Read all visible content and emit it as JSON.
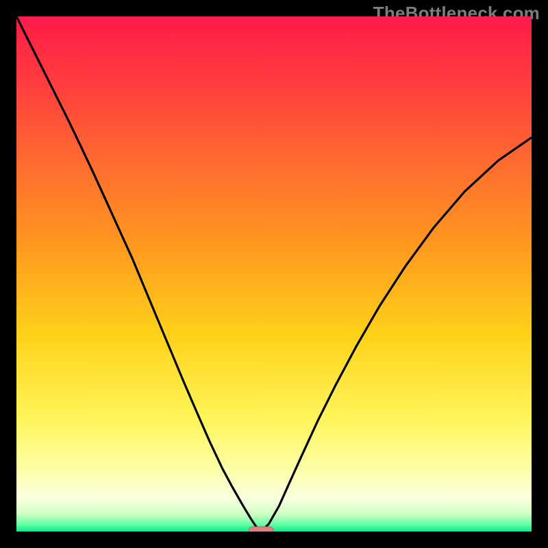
{
  "watermark": "TheBottleneck.com",
  "colors": {
    "frame": "#000000",
    "curve": "#000000",
    "marker_fill": "#e08080",
    "marker_stroke": "#c86060",
    "gradient_stops": [
      {
        "offset": 0.0,
        "color": "#ff1b4b"
      },
      {
        "offset": 0.12,
        "color": "#ff3a3f"
      },
      {
        "offset": 0.28,
        "color": "#ff6a30"
      },
      {
        "offset": 0.45,
        "color": "#ff9a1f"
      },
      {
        "offset": 0.62,
        "color": "#ffd21a"
      },
      {
        "offset": 0.78,
        "color": "#fff55a"
      },
      {
        "offset": 0.88,
        "color": "#fdffa8"
      },
      {
        "offset": 0.935,
        "color": "#faffe0"
      },
      {
        "offset": 0.965,
        "color": "#d2ffc6"
      },
      {
        "offset": 0.985,
        "color": "#6bffa8"
      },
      {
        "offset": 1.0,
        "color": "#00ef8b"
      }
    ]
  },
  "chart_data": {
    "type": "line",
    "title": "",
    "xlabel": "",
    "ylabel": "",
    "xlim": [
      0,
      1
    ],
    "ylim": [
      0,
      1
    ],
    "x": [
      0.0,
      0.025,
      0.05,
      0.075,
      0.1,
      0.125,
      0.15,
      0.175,
      0.2,
      0.225,
      0.25,
      0.275,
      0.3,
      0.325,
      0.35,
      0.375,
      0.4,
      0.42,
      0.44,
      0.455,
      0.465,
      0.475,
      0.49,
      0.51,
      0.53,
      0.555,
      0.585,
      0.62,
      0.66,
      0.705,
      0.755,
      0.81,
      0.87,
      0.935,
      1.0
    ],
    "values": [
      1.0,
      0.95,
      0.9,
      0.85,
      0.8,
      0.748,
      0.695,
      0.64,
      0.585,
      0.53,
      0.47,
      0.41,
      0.35,
      0.29,
      0.232,
      0.175,
      0.122,
      0.085,
      0.05,
      0.025,
      0.01,
      0.0,
      0.015,
      0.05,
      0.095,
      0.15,
      0.215,
      0.285,
      0.36,
      0.438,
      0.515,
      0.59,
      0.66,
      0.72,
      0.765
    ],
    "minimum_marker": {
      "x": 0.475,
      "y": 0.0
    },
    "notes": "Background is a vertical red→yellow→green gradient; y-axis encodes bottleneck severity (top=red=bad, bottom=green=good). Curve dips to zero at x≈0.475."
  }
}
